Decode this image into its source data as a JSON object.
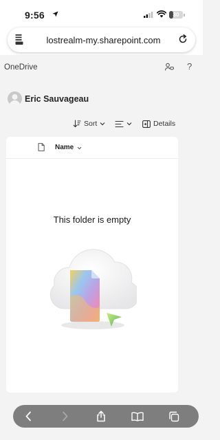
{
  "status_bar": {
    "time": "9:56",
    "battery": "30",
    "battery_level": 0.3
  },
  "browser": {
    "url": "lostrealm-my.sharepoint.com"
  },
  "app": {
    "title": "OneDrive",
    "help": "?"
  },
  "user": {
    "name": "Eric Sauvageau"
  },
  "commands": {
    "sort": "Sort",
    "details": "Details"
  },
  "file_list": {
    "column_name": "Name",
    "empty_message": "This folder is empty"
  },
  "icons": {
    "status": [
      "location-arrow-icon",
      "cellular-signal-icon",
      "wifi-icon",
      "battery-icon"
    ],
    "browser": [
      "page-menu-icon",
      "reload-icon"
    ],
    "header": [
      "share-icon",
      "help-icon"
    ],
    "commands": [
      "sort-icon",
      "view-options-icon",
      "details-pane-icon"
    ],
    "toolbar": [
      "back-icon",
      "forward-icon",
      "share-icon",
      "bookmarks-icon",
      "tabs-icon"
    ]
  },
  "colors": {
    "toolbar": "#7e7e7e",
    "page_background": "#f3f3f3",
    "card": "#ffffff"
  }
}
